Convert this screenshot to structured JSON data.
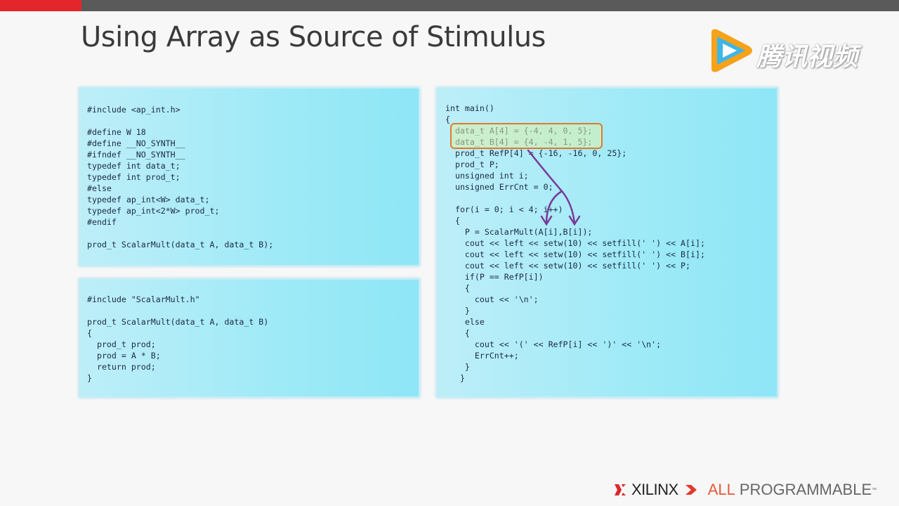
{
  "slide": {
    "title": "Using Array as Source of Stimulus"
  },
  "watermark": {
    "text": "腾讯视频"
  },
  "header_code": [
    "#include <ap_int.h>",
    "",
    "#define W 18",
    "#define __NO_SYNTH__",
    "#ifndef __NO_SYNTH__",
    "typedef int data_t;",
    "typedef int prod_t;",
    "#else",
    "typedef ap_int<W> data_t;",
    "typedef ap_int<2*W> prod_t;",
    "#endif",
    "",
    "prod_t ScalarMult(data_t A, data_t B);"
  ],
  "source_code": [
    "#include \"ScalarMult.h\"",
    "",
    "prod_t ScalarMult(data_t A, data_t B)",
    "{",
    "  prod_t prod;",
    "  prod = A * B;",
    "  return prod;",
    "}"
  ],
  "main_code": [
    "int main()",
    "{",
    "  data_t A[4] = {-4, 4, 0, 5};",
    "  data_t B[4] = {4, -4, 1, 5};",
    "  prod_t RefP[4] = {-16, -16, 0, 25};",
    "  prod_t P;",
    "  unsigned int i;",
    "  unsigned ErrCnt = 0;",
    "",
    "  for(i = 0; i < 4; i++)",
    "  {",
    "    P = ScalarMult(A[i],B[i]);",
    "    cout << left << setw(10) << setfill(' ') << A[i];",
    "    cout << left << setw(10) << setfill(' ') << B[i];",
    "    cout << left << setw(10) << setfill(' ') << P;",
    "    if(P == RefP[i])",
    "    {",
    "      cout << '\\n';",
    "    }",
    "    else",
    "    {",
    "      cout << '(' << RefP[i] << ')' << '\\n';",
    "      ErrCnt++;",
    "    }",
    "   }"
  ],
  "footer": {
    "brand": "XILINX",
    "tagline_1": "ALL",
    "tagline_2": "PROGRAMMABLE",
    "tm": "™"
  },
  "colors": {
    "accent_red": "#e3262b",
    "highlight_border": "#e07a2a",
    "arrow": "#7a3a9a"
  }
}
